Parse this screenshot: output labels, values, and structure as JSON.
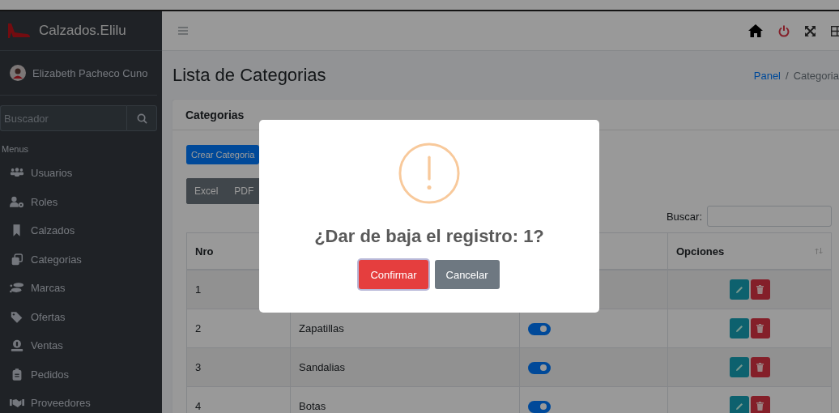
{
  "sidebar": {
    "brand": "Calzados.Elilu",
    "user": "Elizabeth Pacheco Cuno",
    "search": {
      "placeholder": "Buscador"
    },
    "section": "Menus",
    "items": [
      {
        "label": "Usuarios",
        "kind": "users"
      },
      {
        "label": "Roles",
        "kind": "usergear"
      },
      {
        "label": "Calzados",
        "kind": "bookmark"
      },
      {
        "label": "Categorias",
        "kind": "copy"
      },
      {
        "label": "Marcas",
        "kind": "footprints"
      },
      {
        "label": "Ofertas",
        "kind": "tag"
      },
      {
        "label": "Ventas",
        "kind": "coin"
      },
      {
        "label": "Pedidos",
        "kind": "clipboard"
      },
      {
        "label": "Proveedores",
        "kind": "handshake"
      }
    ]
  },
  "page": {
    "title": "Lista de Categorias",
    "breadcrumb": [
      {
        "label": "Panel",
        "link": true
      },
      {
        "label": "Categoria",
        "link": false
      }
    ],
    "separator": "/"
  },
  "card": {
    "title": "Categorias",
    "create_button": "Crear Categoria",
    "export_buttons": [
      "Excel",
      "PDF"
    ],
    "search_label": "Buscar:"
  },
  "table": {
    "columns": [
      {
        "label": "Nro"
      },
      {},
      {},
      {
        "label": "Opciones"
      }
    ],
    "rows": [
      {
        "nro": "1"
      },
      {
        "nro": "2",
        "name": "Zapatillas",
        "active": true
      },
      {
        "nro": "3",
        "name": "Sandalias",
        "active": true
      },
      {
        "nro": "4",
        "name": "Botas",
        "active": true
      }
    ]
  },
  "dialog": {
    "title": "¿Dar de baja el registro: 1?",
    "confirm": "Confirmar",
    "cancel": "Cancelar"
  }
}
